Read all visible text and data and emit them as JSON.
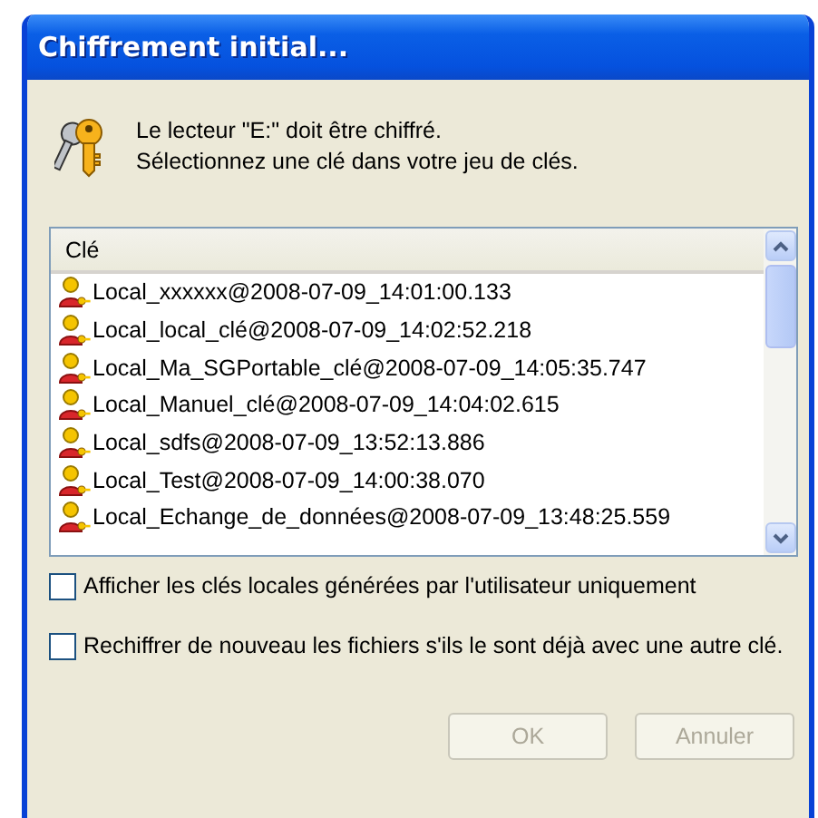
{
  "window": {
    "title": "Chiffrement initial..."
  },
  "message": [
    "Le lecteur \"E:\" doit être chiffré.",
    "Sélectionnez une clé dans votre jeu de clés."
  ],
  "key_list": {
    "column": "Clé",
    "rows": [
      {
        "label": "Local_xxxxxx@2008-07-09_14:01:00.133"
      },
      {
        "label": "Local_local_clé@2008-07-09_14:02:52.218"
      },
      {
        "label": "Local_Ma_SGPortable_clé@2008-07-09_14:05:35.747"
      },
      {
        "label": "Local_Manuel_clé@2008-07-09_14:04:02.615"
      },
      {
        "label": "Local_sdfs@2008-07-09_13:52:13.886"
      },
      {
        "label": "Local_Test@2008-07-09_14:00:38.070"
      },
      {
        "label": "Local_Echange_de_données@2008-07-09_13:48:25.559"
      }
    ]
  },
  "options": [
    {
      "label": "Afficher les clés locales générées par l'utilisateur uniquement",
      "checked": false
    },
    {
      "label": "Rechiffrer de nouveau les fichiers s'ils le sont déjà avec une autre clé.",
      "checked": false
    }
  ],
  "buttons": [
    {
      "label": "OK",
      "disabled": true
    },
    {
      "label": "Annuler",
      "disabled": true
    }
  ]
}
